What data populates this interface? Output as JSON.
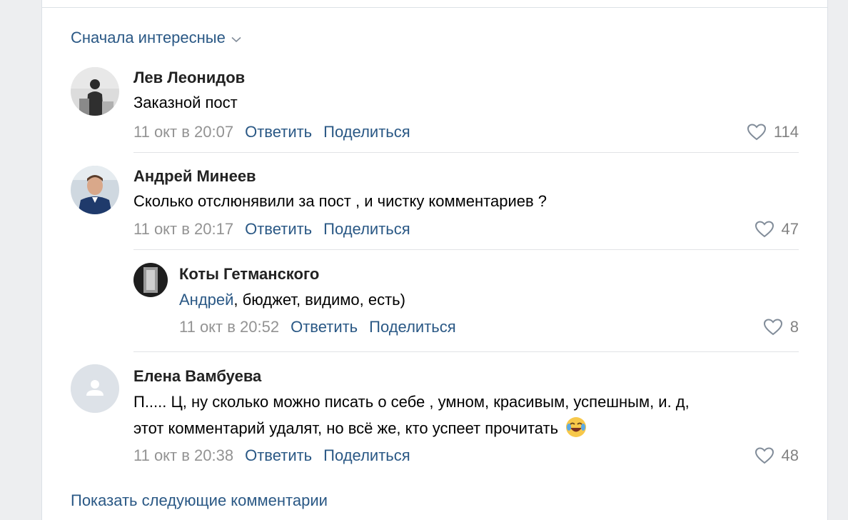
{
  "sort_label": "Сначала интересные",
  "comments": [
    {
      "author": "Лев Леонидов",
      "text": "Заказной пост",
      "date": "11 окт в 20:07",
      "reply": "Ответить",
      "share": "Поделиться",
      "likes": "114"
    },
    {
      "author": "Андрей Минеев",
      "text": "Сколько отслюнявили за пост , и чистку комментариев ?",
      "date": "11 окт в 20:17",
      "reply": "Ответить",
      "share": "Поделиться",
      "likes": "47"
    },
    {
      "author": "Коты Гетманского",
      "mention": "Андрей",
      "text": ", бюджет, видимо, есть)",
      "date": "11 окт в 20:52",
      "reply": "Ответить",
      "share": "Поделиться",
      "likes": "8"
    },
    {
      "author": "Елена Вамбуева",
      "text_line1": "П..... Ц, ну сколько можно писать о себе , умном, красивым, успешным, и. д,",
      "text_line2": "этот комментарий удалят, но всё же, кто успеет прочитать",
      "date": "11 окт в 20:38",
      "reply": "Ответить",
      "share": "Поделиться",
      "likes": "48"
    }
  ],
  "show_more": "Показать следующие комментарии",
  "colors": {
    "link": "#2a5885",
    "meta": "#939393",
    "divider": "#e1e3e6",
    "background": "#edeef0"
  },
  "icons": [
    "chevron-down-icon",
    "heart-icon",
    "user-placeholder-icon",
    "laughing-emoji-icon"
  ]
}
